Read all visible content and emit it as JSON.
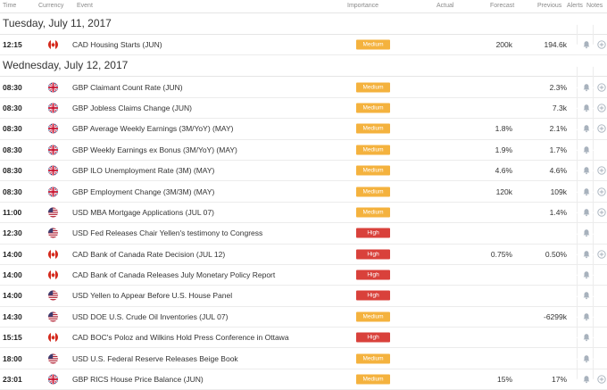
{
  "columns": {
    "time": "Time",
    "currency": "Currency",
    "event": "Event",
    "importance": "Importance",
    "actual": "Actual",
    "forecast": "Forecast",
    "previous": "Previous",
    "alerts": "Alerts",
    "notes": "Notes"
  },
  "colors": {
    "medium": "#f4b23e",
    "high": "#d9413b"
  },
  "days": [
    {
      "date": "Tuesday, July 11, 2017",
      "events": [
        {
          "time": "12:15",
          "currency": "CAD",
          "event": "CAD Housing Starts (JUN)",
          "importance": "Medium",
          "actual": "",
          "forecast": "200k",
          "previous": "194.6k",
          "add_note": true
        }
      ]
    },
    {
      "date": "Wednesday, July 12, 2017",
      "events": [
        {
          "time": "08:30",
          "currency": "GBP",
          "event": "GBP Claimant Count Rate (JUN)",
          "importance": "Medium",
          "actual": "",
          "forecast": "",
          "previous": "2.3%",
          "add_note": true
        },
        {
          "time": "08:30",
          "currency": "GBP",
          "event": "GBP Jobless Claims Change (JUN)",
          "importance": "Medium",
          "actual": "",
          "forecast": "",
          "previous": "7.3k",
          "add_note": true
        },
        {
          "time": "08:30",
          "currency": "GBP",
          "event": "GBP Average Weekly Earnings (3M/YoY) (MAY)",
          "importance": "Medium",
          "actual": "",
          "forecast": "1.8%",
          "previous": "2.1%",
          "add_note": true
        },
        {
          "time": "08:30",
          "currency": "GBP",
          "event": "GBP Weekly Earnings ex Bonus (3M/YoY) (MAY)",
          "importance": "Medium",
          "actual": "",
          "forecast": "1.9%",
          "previous": "1.7%",
          "add_note": false
        },
        {
          "time": "08:30",
          "currency": "GBP",
          "event": "GBP ILO Unemployment Rate (3M) (MAY)",
          "importance": "Medium",
          "actual": "",
          "forecast": "4.6%",
          "previous": "4.6%",
          "add_note": true
        },
        {
          "time": "08:30",
          "currency": "GBP",
          "event": "GBP Employment Change (3M/3M) (MAY)",
          "importance": "Medium",
          "actual": "",
          "forecast": "120k",
          "previous": "109k",
          "add_note": true
        },
        {
          "time": "11:00",
          "currency": "USD",
          "event": "USD MBA Mortgage Applications (JUL 07)",
          "importance": "Medium",
          "actual": "",
          "forecast": "",
          "previous": "1.4%",
          "add_note": true
        },
        {
          "time": "12:30",
          "currency": "USD",
          "event": "USD Fed Releases Chair Yellen's testimony to Congress",
          "importance": "High",
          "actual": "",
          "forecast": "",
          "previous": "",
          "add_note": false
        },
        {
          "time": "14:00",
          "currency": "CAD",
          "event": "CAD Bank of Canada Rate Decision (JUL 12)",
          "importance": "High",
          "actual": "",
          "forecast": "0.75%",
          "previous": "0.50%",
          "add_note": true
        },
        {
          "time": "14:00",
          "currency": "CAD",
          "event": "CAD Bank of Canada Releases July Monetary Policy Report",
          "importance": "High",
          "actual": "",
          "forecast": "",
          "previous": "",
          "add_note": false
        },
        {
          "time": "14:00",
          "currency": "USD",
          "event": "USD Yellen to Appear Before U.S. House Panel",
          "importance": "High",
          "actual": "",
          "forecast": "",
          "previous": "",
          "add_note": false
        },
        {
          "time": "14:30",
          "currency": "USD",
          "event": "USD DOE U.S. Crude Oil Inventories (JUL 07)",
          "importance": "Medium",
          "actual": "",
          "forecast": "",
          "previous": "-6299k",
          "add_note": false
        },
        {
          "time": "15:15",
          "currency": "CAD",
          "event": "CAD BOC's Poloz and Wilkins Hold Press Conference in Ottawa",
          "importance": "High",
          "actual": "",
          "forecast": "",
          "previous": "",
          "add_note": false
        },
        {
          "time": "18:00",
          "currency": "USD",
          "event": "USD U.S. Federal Reserve Releases Beige Book",
          "importance": "Medium",
          "actual": "",
          "forecast": "",
          "previous": "",
          "add_note": false
        },
        {
          "time": "23:01",
          "currency": "GBP",
          "event": "GBP RICS House Price Balance (JUN)",
          "importance": "Medium",
          "actual": "",
          "forecast": "15%",
          "previous": "17%",
          "add_note": true
        }
      ]
    }
  ]
}
